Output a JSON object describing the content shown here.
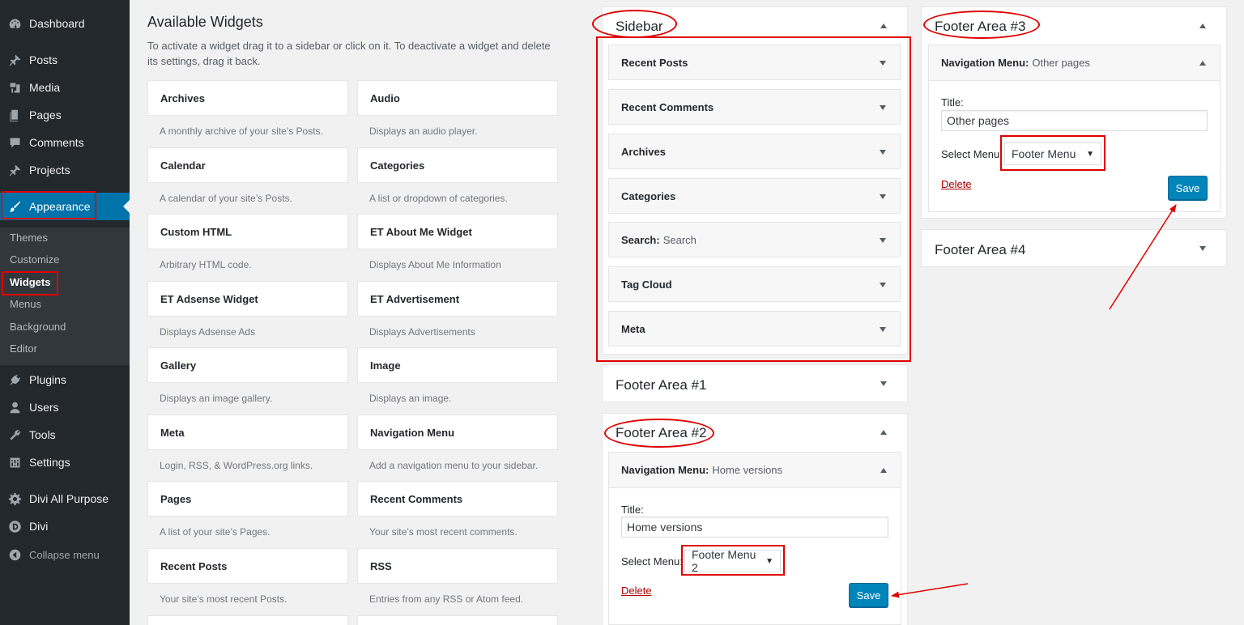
{
  "menu": {
    "items": [
      {
        "label": "Dashboard",
        "icon": "dashboard-icon"
      },
      {
        "label": "Posts",
        "icon": "pin-icon"
      },
      {
        "label": "Media",
        "icon": "media-icon"
      },
      {
        "label": "Pages",
        "icon": "pages-icon"
      },
      {
        "label": "Comments",
        "icon": "comment-icon"
      },
      {
        "label": "Projects",
        "icon": "pin-icon"
      },
      {
        "label": "Appearance",
        "icon": "paintbrush-icon"
      },
      {
        "label": "Plugins",
        "icon": "plug-icon"
      },
      {
        "label": "Users",
        "icon": "user-icon"
      },
      {
        "label": "Tools",
        "icon": "wrench-icon"
      },
      {
        "label": "Settings",
        "icon": "settings-icon"
      },
      {
        "label": "Divi All Purpose",
        "icon": "gear-icon"
      },
      {
        "label": "Divi",
        "icon": "divi-logo-icon"
      },
      {
        "label": "Collapse menu",
        "icon": "collapse-arrow-icon"
      }
    ],
    "submenu": [
      "Themes",
      "Customize",
      "Widgets",
      "Menus",
      "Background",
      "Editor"
    ]
  },
  "available": {
    "title": "Available Widgets",
    "description": "To activate a widget drag it to a sidebar or click on it. To deactivate a widget and delete its settings, drag it back.",
    "widgets": [
      {
        "name": "Archives",
        "desc": "A monthly archive of your site’s Posts."
      },
      {
        "name": "Audio",
        "desc": "Displays an audio player."
      },
      {
        "name": "Calendar",
        "desc": "A calendar of your site’s Posts."
      },
      {
        "name": "Categories",
        "desc": "A list or dropdown of categories."
      },
      {
        "name": "Custom HTML",
        "desc": "Arbitrary HTML code."
      },
      {
        "name": "ET About Me Widget",
        "desc": "Displays About Me Information"
      },
      {
        "name": "ET Adsense Widget",
        "desc": "Displays Adsense Ads"
      },
      {
        "name": "ET Advertisement",
        "desc": "Displays Advertisements"
      },
      {
        "name": "Gallery",
        "desc": "Displays an image gallery."
      },
      {
        "name": "Image",
        "desc": "Displays an image."
      },
      {
        "name": "Meta",
        "desc": "Login, RSS, & WordPress.org links."
      },
      {
        "name": "Navigation Menu",
        "desc": "Add a navigation menu to your sidebar."
      },
      {
        "name": "Pages",
        "desc": "A list of your site’s Pages."
      },
      {
        "name": "Recent Comments",
        "desc": "Your site’s most recent comments."
      },
      {
        "name": "Recent Posts",
        "desc": "Your site’s most recent Posts."
      },
      {
        "name": "RSS",
        "desc": "Entries from any RSS or Atom feed."
      }
    ]
  },
  "sidebar": {
    "title": "Sidebar",
    "widgets": [
      {
        "name": "Recent Posts",
        "sub": ""
      },
      {
        "name": "Recent Comments",
        "sub": ""
      },
      {
        "name": "Archives",
        "sub": ""
      },
      {
        "name": "Categories",
        "sub": ""
      },
      {
        "name": "Search:",
        "sub": "Search"
      },
      {
        "name": "Tag Cloud",
        "sub": ""
      },
      {
        "name": "Meta",
        "sub": ""
      }
    ]
  },
  "footer1": {
    "title": "Footer Area #1"
  },
  "footer2": {
    "title": "Footer Area #2",
    "widget_name": "Navigation Menu:",
    "widget_sub": "Home versions",
    "title_label": "Title:",
    "title_value": "Home versions",
    "select_label": "Select Menu:",
    "select_value": "Footer Menu 2",
    "delete_label": "Delete",
    "save_label": "Save"
  },
  "footer3": {
    "title": "Footer Area #3",
    "widget_name": "Navigation Menu:",
    "widget_sub": "Other pages",
    "title_label": "Title:",
    "title_value": "Other pages",
    "select_label": "Select Menu:",
    "select_value": "Footer Menu",
    "delete_label": "Delete",
    "save_label": "Save"
  },
  "footer4": {
    "title": "Footer Area #4"
  },
  "colors": {
    "accent": "#0073aa",
    "annotation": "#e00000",
    "menu_bg": "#23282d"
  }
}
